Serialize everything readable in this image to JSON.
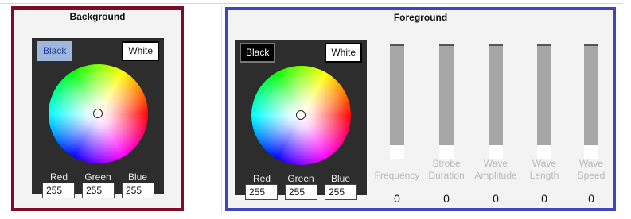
{
  "background": {
    "title": "Background",
    "buttons": {
      "black": "Black",
      "white": "White"
    },
    "rgb": {
      "red_label": "Red",
      "green_label": "Green",
      "blue_label": "Blue",
      "red": "255",
      "green": "255",
      "blue": "255"
    }
  },
  "foreground": {
    "title": "Foreground",
    "buttons": {
      "black": "Black",
      "white": "White"
    },
    "rgb": {
      "red_label": "Red",
      "green_label": "Green",
      "blue_label": "Blue",
      "red": "255",
      "green": "255",
      "blue": "255"
    },
    "sliders": [
      {
        "label_line1": "Frequency",
        "label_line2": "",
        "value": "0"
      },
      {
        "label_line1": "Strobe",
        "label_line2": "Duration",
        "value": "0"
      },
      {
        "label_line1": "Wave",
        "label_line2": "Amplitude",
        "value": "0"
      },
      {
        "label_line1": "Wave",
        "label_line2": "Length",
        "value": "0"
      },
      {
        "label_line1": "Wave",
        "label_line2": "Speed",
        "value": "0"
      }
    ]
  },
  "colors": {
    "background_border": "#7f0c26",
    "foreground_border": "#3e47b9",
    "picker_bg": "#2d2d2d",
    "slider_track": "#a6a6a6"
  }
}
